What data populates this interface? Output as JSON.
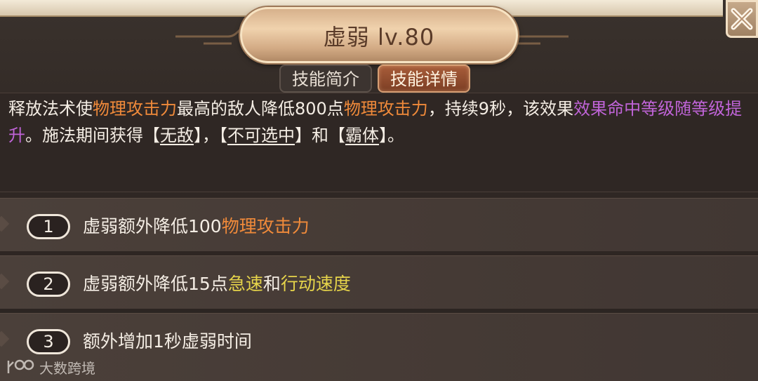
{
  "colors": {
    "accent_orange": "#f08a3a",
    "accent_purple": "#c064d8",
    "accent_yellow": "#e6d44a",
    "active_tab": "#8f4a2c"
  },
  "header": {
    "title": "虚弱 lv.80",
    "close_icon": "close-x-icon"
  },
  "tabs": [
    {
      "label": "技能简介",
      "active": false
    },
    {
      "label": "技能详情",
      "active": true
    }
  ],
  "description": {
    "seg1": "释放法术使",
    "seg2": "物理攻击力",
    "seg3": "最高的敌人降低800点",
    "seg4": "物理攻击力",
    "seg5": "，持续9秒，该效果",
    "seg6": "效果命中等级随等级提升",
    "seg7": "。施法期间获得【",
    "seg8": "无敌",
    "seg9": "】，【",
    "seg10": "不可选中",
    "seg11": "】和【",
    "seg12": "霸体",
    "seg13": "】。"
  },
  "upgrades": [
    {
      "num": "1",
      "plain": "虚弱额外降低100",
      "hl1": "物理攻击力",
      "mid": "",
      "hl2": ""
    },
    {
      "num": "2",
      "plain": "虚弱额外降低15点",
      "hl1": "急速",
      "mid": "和",
      "hl2": "行动速度"
    },
    {
      "num": "3",
      "plain": "额外增加1秒虚弱时间",
      "hl1": "",
      "mid": "",
      "hl2": ""
    }
  ],
  "watermark": {
    "text": "大数跨境",
    "logo_icon": "brand-logo-icon"
  }
}
